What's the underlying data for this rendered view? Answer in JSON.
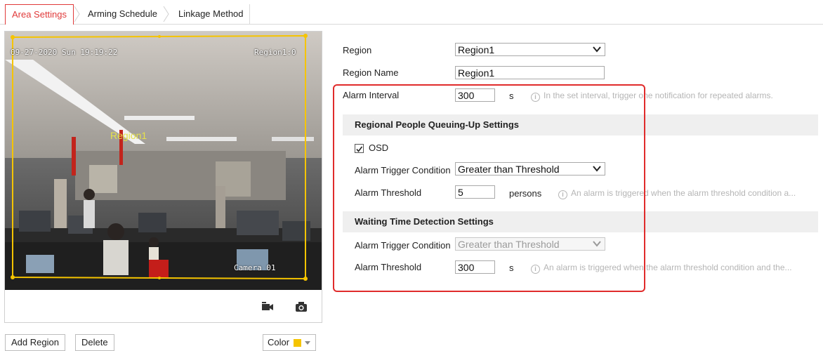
{
  "tabs": [
    {
      "label": "Area Settings",
      "active": true
    },
    {
      "label": "Arming Schedule",
      "active": false
    },
    {
      "label": "Linkage Method",
      "active": false
    }
  ],
  "video": {
    "timestamp": "09-27-2020 Sun 19:19:22",
    "region_count": "Region1:0",
    "region_label": "Region1",
    "camera_name": "Camera 01"
  },
  "video_toolbar": {
    "record_icon": "video-camera-icon",
    "snapshot_icon": "camera-icon"
  },
  "bottom_buttons": {
    "add_region": "Add Region",
    "delete": "Delete",
    "color": "Color",
    "color_value": "#f5c400"
  },
  "form": {
    "region": {
      "label": "Region",
      "value": "Region1"
    },
    "region_name": {
      "label": "Region Name",
      "value": "Region1"
    },
    "alarm_interval": {
      "label": "Alarm Interval",
      "value": "300",
      "unit": "s",
      "hint": "In the set interval, trigger one notification for repeated alarms."
    },
    "queuing_section": {
      "title": "Regional People Queuing-Up Settings",
      "osd": {
        "label": "OSD",
        "checked": true
      },
      "trigger_condition": {
        "label": "Alarm Trigger Condition",
        "value": "Greater than Threshold"
      },
      "threshold": {
        "label": "Alarm Threshold",
        "value": "5",
        "unit": "persons",
        "hint": "An alarm is triggered when the alarm threshold condition a..."
      }
    },
    "waiting_section": {
      "title": "Waiting Time Detection Settings",
      "trigger_condition": {
        "label": "Alarm Trigger Condition",
        "value": "Greater than Threshold",
        "disabled": true
      },
      "threshold": {
        "label": "Alarm Threshold",
        "value": "300",
        "unit": "s",
        "hint": "An alarm is triggered when the alarm threshold condition and the..."
      }
    }
  },
  "colors": {
    "active_tab": "#e03a3a",
    "region_outline": "#f5c400",
    "highlight_box": "#e02b2b",
    "section_bg": "#efefef"
  }
}
